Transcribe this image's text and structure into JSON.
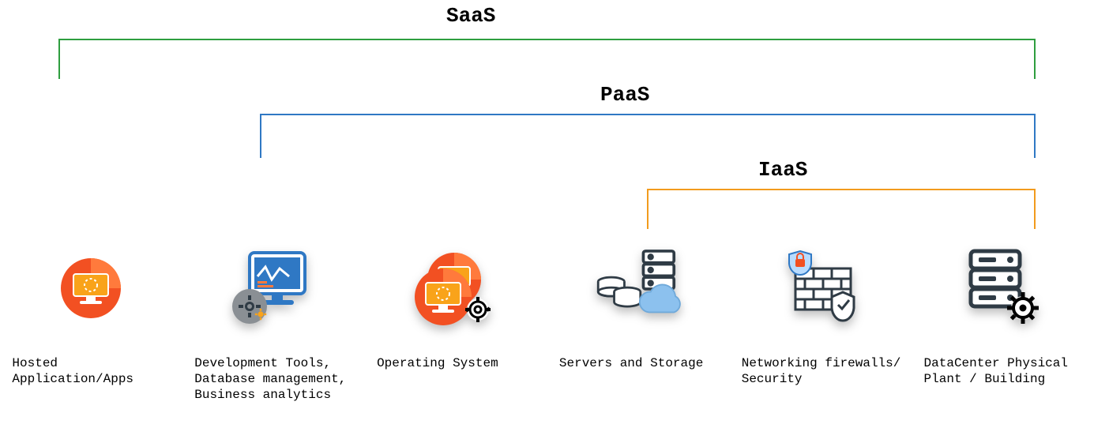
{
  "tiers": {
    "saas": {
      "label": "SaaS",
      "color": "#2e9e3f",
      "spans": [
        0,
        1,
        2,
        3,
        4,
        5
      ]
    },
    "paas": {
      "label": "PaaS",
      "color": "#2f78c4",
      "spans": [
        1,
        2,
        3,
        4,
        5
      ]
    },
    "iaas": {
      "label": "IaaS",
      "color": "#f29b1d",
      "spans": [
        3,
        4,
        5
      ]
    }
  },
  "items": [
    {
      "icon": "hosted-app-icon",
      "label": "Hosted Application/Apps"
    },
    {
      "icon": "dev-tools-icon",
      "label": "Development Tools,\nDatabase management,\nBusiness analytics"
    },
    {
      "icon": "os-icon",
      "label": "Operating System"
    },
    {
      "icon": "servers-icon",
      "label": "Servers and Storage"
    },
    {
      "icon": "firewall-icon",
      "label": "Networking firewalls/\nSecurity"
    },
    {
      "icon": "datacenter-icon",
      "label": "DataCenter Physical\nPlant / Building"
    }
  ],
  "colors": {
    "accent": "#f25022",
    "accent_light": "#ff7a3c",
    "screen": "#f9a31a",
    "sky": "#7cb6ea",
    "dark": "#2f3b45",
    "grey": "#8a8f94"
  }
}
